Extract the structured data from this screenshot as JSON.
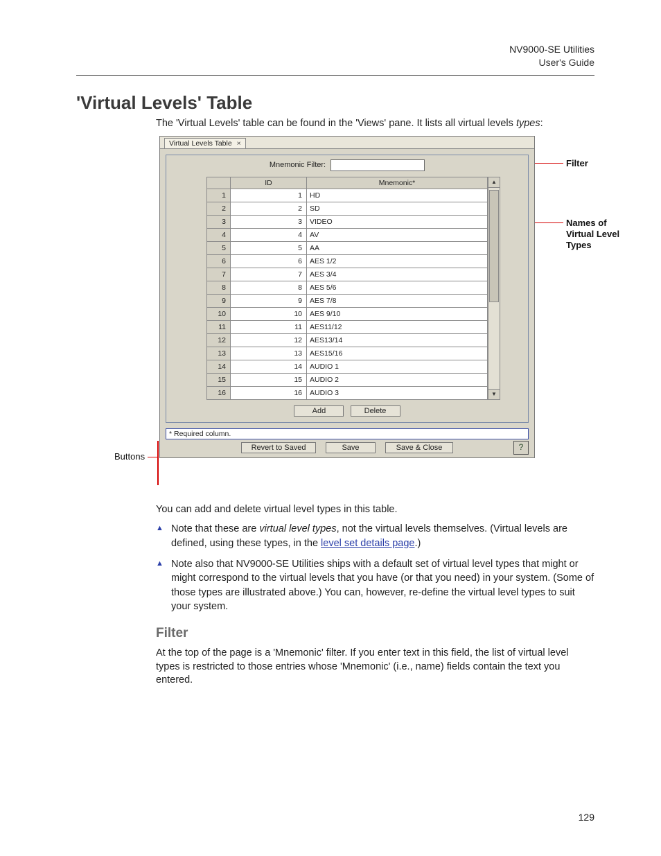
{
  "header": {
    "product": "NV9000-SE Utilities",
    "doc": "User's Guide"
  },
  "h1": "'Virtual Levels' Table",
  "intro_pre": "The 'Virtual Levels' table can be found in the 'Views' pane. It lists all virtual levels ",
  "intro_em": "types",
  "intro_post": ":",
  "callouts": {
    "filter": "Filter",
    "names": "Names of Virtual Level Types",
    "buttons": "Buttons"
  },
  "app": {
    "tab_title": "Virtual Levels Table",
    "filter_label": "Mnemonic Filter:",
    "filter_value": "",
    "columns": {
      "rownum": "",
      "id": "ID",
      "mnemonic": "Mnemonic*"
    },
    "rows": [
      {
        "n": "1",
        "id": "1",
        "mn": "HD"
      },
      {
        "n": "2",
        "id": "2",
        "mn": "SD"
      },
      {
        "n": "3",
        "id": "3",
        "mn": "VIDEO"
      },
      {
        "n": "4",
        "id": "4",
        "mn": "AV"
      },
      {
        "n": "5",
        "id": "5",
        "mn": "AA"
      },
      {
        "n": "6",
        "id": "6",
        "mn": "AES 1/2"
      },
      {
        "n": "7",
        "id": "7",
        "mn": "AES 3/4"
      },
      {
        "n": "8",
        "id": "8",
        "mn": "AES 5/6"
      },
      {
        "n": "9",
        "id": "9",
        "mn": "AES 7/8"
      },
      {
        "n": "10",
        "id": "10",
        "mn": "AES 9/10"
      },
      {
        "n": "11",
        "id": "11",
        "mn": "AES11/12"
      },
      {
        "n": "12",
        "id": "12",
        "mn": "AES13/14"
      },
      {
        "n": "13",
        "id": "13",
        "mn": "AES15/16"
      },
      {
        "n": "14",
        "id": "14",
        "mn": "AUDIO 1"
      },
      {
        "n": "15",
        "id": "15",
        "mn": "AUDIO 2"
      },
      {
        "n": "16",
        "id": "16",
        "mn": "AUDIO 3"
      }
    ],
    "buttons": {
      "add": "Add",
      "delete": "Delete"
    },
    "required_note": "* Required column.",
    "footer": {
      "revert": "Revert to Saved",
      "save": "Save",
      "save_close": "Save & Close",
      "help": "?"
    }
  },
  "after_fig": "You can add and delete virtual level types in this table.",
  "notes": [
    {
      "pre": "Note that these are ",
      "em": "virtual level types",
      "mid": ", not the virtual levels themselves. (Virtual levels are defined, using these types, in the ",
      "link": "level set details page",
      "post": ".)"
    },
    {
      "text": "Note also that NV9000-SE Utilities ships with a default set of virtual level types that might or might correspond to the virtual levels that you have (or that you need) in your system. (Some of those types are illustrated above.) You can, however, re-define the virtual level types to suit your system."
    }
  ],
  "filter_heading": "Filter",
  "filter_body": "At the top of the page is a 'Mnemonic' filter. If you enter text in this field, the list of virtual level types is restricted to those entries whose 'Mnemonic' (i.e., name) fields contain the text you entered.",
  "page_number": "129"
}
